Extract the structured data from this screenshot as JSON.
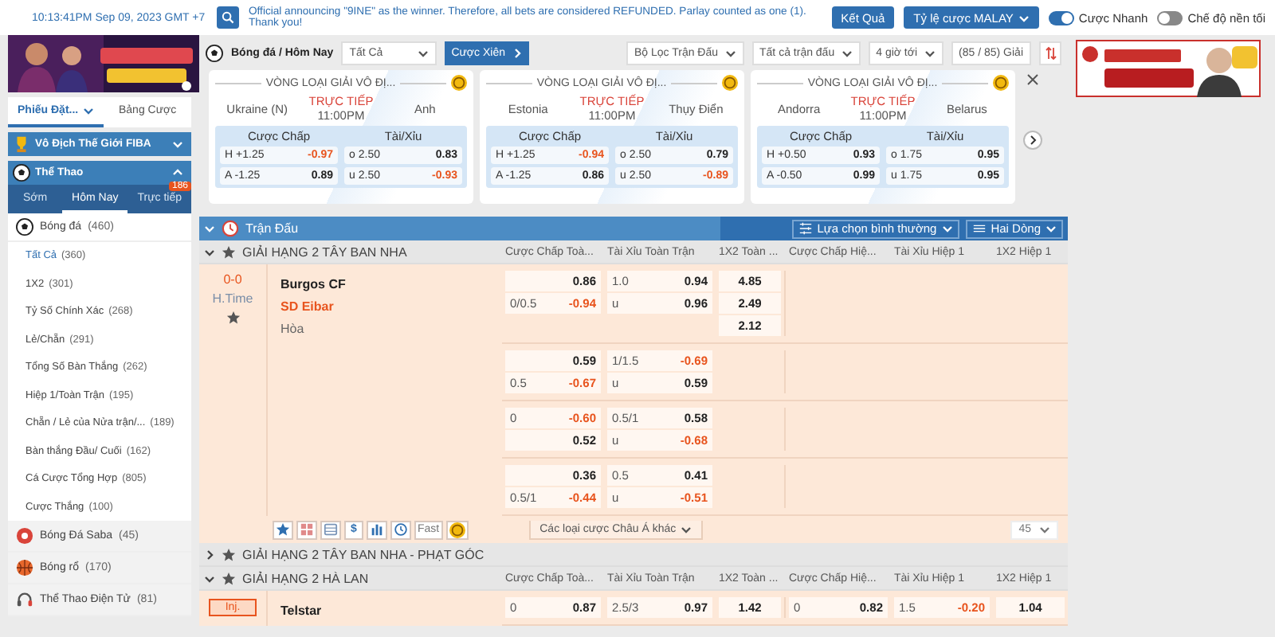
{
  "top_bar": {
    "datetime": "10:13:41PM Sep 09, 2023 GMT +7",
    "announcement": "Official announcing \"9INE\" as the winner. Therefore, all bets are considered REFUNDED. Parlay counted as one (1). Thank you!",
    "results_button": "Kết Quả",
    "odds_format": "Tỷ lệ cược MALAY",
    "toggles": [
      {
        "label": "Cược Nhanh",
        "on": true
      },
      {
        "label": "Chế độ nền tối",
        "on": false
      }
    ]
  },
  "sidebar": {
    "bet_tabs": [
      {
        "label": "Phiếu Đặt...",
        "selected": true
      },
      {
        "label": "Bảng Cược",
        "selected": false
      }
    ],
    "sections": [
      {
        "title": "Vô Địch Thế Giới FIBA",
        "kind": "trophy",
        "expanded": false
      },
      {
        "title": "Thể Thao",
        "kind": "sports",
        "expanded": true
      }
    ],
    "period_tabs": [
      {
        "label": "Sớm",
        "selected": false
      },
      {
        "label": "Hôm Nay",
        "selected": true
      },
      {
        "label": "Trực tiếp",
        "selected": false,
        "badge": "186"
      }
    ],
    "sports": [
      {
        "name": "Bóng đá",
        "count": "(460)",
        "kind": "soccer",
        "children": [
          {
            "label": "Tất Cả",
            "count": "(360)",
            "selected": true
          },
          {
            "label": "1X2",
            "count": "(301)",
            "selected": false
          },
          {
            "label": "Tỷ Số Chính Xác",
            "count": "(268)",
            "selected": false
          },
          {
            "label": "Lẻ/Chẵn",
            "count": "(291)",
            "selected": false
          },
          {
            "label": "Tổng Số Bàn Thắng",
            "count": "(262)",
            "selected": false
          },
          {
            "label": "Hiệp 1/Toàn Trận",
            "count": "(195)",
            "selected": false
          },
          {
            "label": "Chẵn / Lẻ của Nửa trận/...",
            "count": "(189)",
            "selected": false
          },
          {
            "label": "Bàn thắng Đầu/ Cuối",
            "count": "(162)",
            "selected": false
          },
          {
            "label": "Cá Cược Tổng Hợp",
            "count": "(805)",
            "selected": false
          },
          {
            "label": "Cược Thắng",
            "count": "(100)",
            "selected": false
          }
        ]
      },
      {
        "name": "Bóng Đá Saba",
        "count": "(45)",
        "kind": "saba"
      },
      {
        "name": "Bóng rổ",
        "count": "(170)",
        "kind": "basketball"
      },
      {
        "name": "Thể Thao Điện Tử",
        "count": "(81)",
        "kind": "esports"
      }
    ]
  },
  "toolbar": {
    "breadcrumb": "Bóng đá / Hôm Nay",
    "market_select": "Tất Cả",
    "parlay_button": "Cược Xiên",
    "filters": [
      "Bộ Lọc Trận Đấu",
      "Tất cả trận đấu",
      "4 giờ tới"
    ],
    "league_count": "(85 / 85) Giải"
  },
  "featured": [
    {
      "league": "VÒNG LOẠI GIẢI VÔ ĐỊ...",
      "home": "Ukraine (N)",
      "away": "Anh",
      "status": "TRỰC TIẾP",
      "time": "11:00PM",
      "handicap_label": "Cược Chấp",
      "ou_label": "Tài/Xỉu",
      "handicap": [
        {
          "side": "H",
          "line": "+1.25",
          "odds": "-0.97"
        },
        {
          "side": "A",
          "line": "-1.25",
          "odds": "0.89"
        }
      ],
      "over_under": [
        {
          "side": "o",
          "line": "2.50",
          "odds": "0.83"
        },
        {
          "side": "u",
          "line": "2.50",
          "odds": "-0.93"
        }
      ]
    },
    {
      "league": "VÒNG LOẠI GIẢI VÔ ĐỊ...",
      "home": "Estonia",
      "away": "Thụy Điển",
      "status": "TRỰC TIẾP",
      "time": "11:00PM",
      "handicap_label": "Cược Chấp",
      "ou_label": "Tài/Xỉu",
      "handicap": [
        {
          "side": "H",
          "line": "+1.25",
          "odds": "-0.94"
        },
        {
          "side": "A",
          "line": "-1.25",
          "odds": "0.86"
        }
      ],
      "over_under": [
        {
          "side": "o",
          "line": "2.50",
          "odds": "0.79"
        },
        {
          "side": "u",
          "line": "2.50",
          "odds": "-0.89"
        }
      ]
    },
    {
      "league": "VÒNG LOẠI GIẢI VÔ ĐỊ...",
      "home": "Andorra",
      "away": "Belarus",
      "status": "TRỰC TIẾP",
      "time": "11:00PM",
      "handicap_label": "Cược Chấp",
      "ou_label": "Tài/Xỉu",
      "handicap": [
        {
          "side": "H",
          "line": "+0.50",
          "odds": "0.93"
        },
        {
          "side": "A",
          "line": "-0.50",
          "odds": "0.99"
        }
      ],
      "over_under": [
        {
          "side": "o",
          "line": "1.75",
          "odds": "0.95"
        },
        {
          "side": "u",
          "line": "1.75",
          "odds": "0.95"
        }
      ]
    }
  ],
  "matches_panel": {
    "title": "Trận Đấu",
    "view_select": "Lựa chọn bình thường",
    "lines_select": "Hai Dòng",
    "leagues": [
      {
        "name": "GIẢI HẠNG 2 TÂY BAN NHA",
        "expanded": true,
        "columns": [
          "Cược Chấp Toà...",
          "Tài Xỉu Toàn Trận",
          "1X2 Toàn ...",
          "Cược Chấp Hiệ...",
          "Tài Xỉu Hiệp 1",
          "1X2 Hiệp 1"
        ],
        "matches": [
          {
            "score": "0-0",
            "period": "H.Time",
            "teams": [
              {
                "name": "Burgos CF",
                "kind": "team"
              },
              {
                "name": "SD Eibar",
                "kind": "favorite"
              },
              {
                "name": "Hòa",
                "kind": "draw"
              }
            ],
            "odds_groups": [
              {
                "ft_handicap": [
                  {
                    "odds": "0.86"
                  },
                  {
                    "line": "0/0.5",
                    "odds": "-0.94"
                  }
                ],
                "ft_over_under": [
                  {
                    "line": "1.0",
                    "odds": "0.94"
                  },
                  {
                    "line": "u",
                    "odds": "0.96"
                  }
                ],
                "ft_1x2": [
                  "4.85",
                  "2.49",
                  "2.12"
                ]
              },
              {
                "ft_handicap": [
                  {
                    "odds": "0.59"
                  },
                  {
                    "line": "0.5",
                    "odds": "-0.67"
                  }
                ],
                "ft_over_under": [
                  {
                    "line": "1/1.5",
                    "odds": "-0.69"
                  },
                  {
                    "line": "u",
                    "odds": "0.59"
                  }
                ]
              },
              {
                "ft_handicap": [
                  {
                    "line": "0",
                    "odds": "-0.60"
                  },
                  {
                    "odds": "0.52"
                  }
                ],
                "ft_over_under": [
                  {
                    "line": "0.5/1",
                    "odds": "0.58"
                  },
                  {
                    "line": "u",
                    "odds": "-0.68"
                  }
                ]
              },
              {
                "ft_handicap": [
                  {
                    "odds": "0.36"
                  },
                  {
                    "line": "0.5/1",
                    "odds": "-0.44"
                  }
                ],
                "ft_over_under": [
                  {
                    "line": "0.5",
                    "odds": "0.41"
                  },
                  {
                    "line": "u",
                    "odds": "-0.51"
                  }
                ]
              }
            ],
            "tools": [
              {
                "kind": "star"
              },
              {
                "kind": "grid"
              },
              {
                "kind": "table"
              },
              {
                "kind": "text",
                "label": "$"
              },
              {
                "kind": "chart"
              },
              {
                "kind": "clock"
              },
              {
                "kind": "text",
                "label": "Fast"
              },
              {
                "kind": "coin"
              }
            ],
            "more_markets": "Các loại cược Châu Á khác",
            "market_count": "45"
          }
        ]
      },
      {
        "name": "GIẢI HẠNG 2 TÂY BAN NHA - PHẠT GÓC",
        "expanded": false
      },
      {
        "name": "GIẢI HẠNG 2 HÀ LAN",
        "expanded": true,
        "columns": [
          "Cược Chấp Toà...",
          "Tài Xỉu Toàn Trận",
          "1X2 Toàn ...",
          "Cược Chấp Hiệ...",
          "Tài Xỉu Hiệp 1",
          "1X2 Hiệp 1"
        ],
        "matches": [
          {
            "status_badge": "Inj.",
            "teams": [
              {
                "name": "Telstar",
                "kind": "team"
              }
            ],
            "odds_groups": [
              {
                "ft_handicap": [
                  {
                    "line": "0",
                    "odds": "0.87"
                  }
                ],
                "ft_over_under": [
                  {
                    "line": "2.5/3",
                    "odds": "0.97"
                  }
                ],
                "ft_1x2": [
                  "1.42"
                ],
                "h1_handicap": [
                  {
                    "line": "0",
                    "odds": "0.82"
                  }
                ],
                "h1_over_under": [
                  {
                    "line": "1.5",
                    "odds": "-0.20"
                  }
                ],
                "h1_1x2": [
                  "1.04"
                ]
              }
            ]
          }
        ]
      }
    ]
  }
}
